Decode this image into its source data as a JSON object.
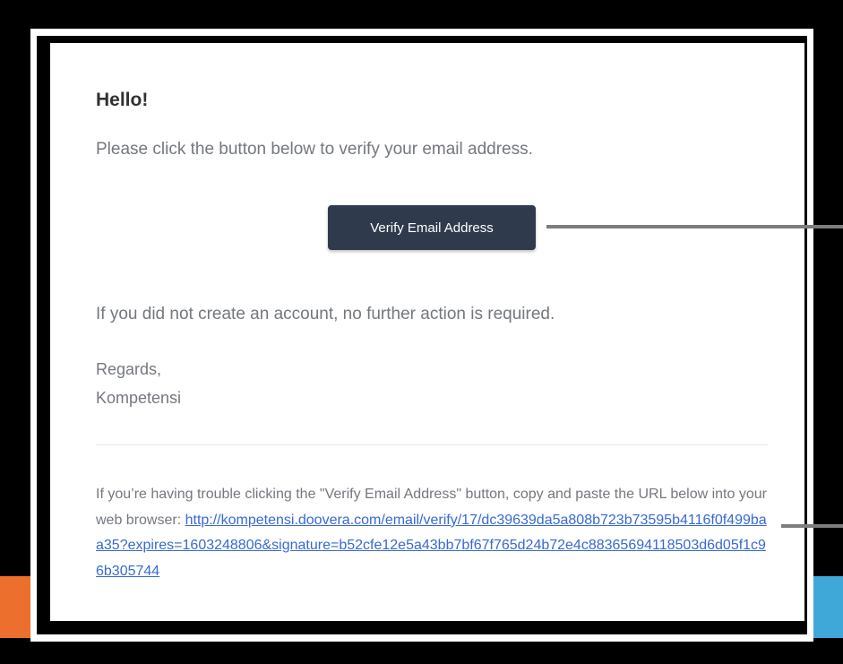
{
  "email": {
    "greeting": "Hello!",
    "intro": "Please click the button below to verify your email address.",
    "verify_button_label": "Verify Email Address",
    "no_action": "If you did not create an account, no further action is required.",
    "regards": "Regards,",
    "sender": "Kompetensi",
    "subcopy_text": "If you’re having trouble clicking the \"Verify Email Address\" button, copy and paste the URL below into your web browser: ",
    "verify_url": "http://kompetensi.doovera.com/email/verify/17/dc39639da5a808b723b73595b4116f0f499baa35?expires=1603248806&signature=b52cfe12e5a43bb7bf67f765d24b72e4c88365694118503d6d05f1c96b305744"
  },
  "colors": {
    "button_bg": "#2f3b4d",
    "link": "#3869d4",
    "body_text": "#74787e",
    "accent_orange": "#ec6f2d",
    "accent_blue": "#3fa8d8"
  }
}
